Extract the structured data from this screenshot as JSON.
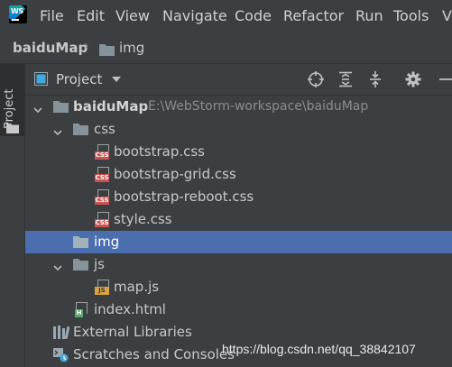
{
  "app": {
    "logo_text": "WS"
  },
  "menu": {
    "items": [
      {
        "label": "File",
        "name": "menu-file"
      },
      {
        "label": "Edit",
        "name": "menu-edit"
      },
      {
        "label": "View",
        "name": "menu-view"
      },
      {
        "label": "Navigate",
        "name": "menu-navigate"
      },
      {
        "label": "Code",
        "name": "menu-code"
      },
      {
        "label": "Refactor",
        "name": "menu-refactor"
      },
      {
        "label": "Run",
        "name": "menu-run"
      },
      {
        "label": "Tools",
        "name": "menu-tools"
      },
      {
        "label": "V",
        "name": "menu-vcs-truncated"
      }
    ]
  },
  "breadcrumb": {
    "project": "baiduMap",
    "separator": "›",
    "folder": "img"
  },
  "toolstrip": {
    "project_tab_label": "Project"
  },
  "project_panel": {
    "title": "Project",
    "tools": [
      "locate-icon",
      "expand-all-icon",
      "collapse-all-icon",
      "gear-icon",
      "hide-icon"
    ]
  },
  "tree": {
    "root": {
      "label": "baiduMap",
      "path": "E:\\WebStorm-workspace\\baiduMap"
    },
    "css_folder": "css",
    "css_files": [
      "bootstrap.css",
      "bootstrap-grid.css",
      "bootstrap-reboot.css",
      "style.css"
    ],
    "img_folder": "img",
    "js_folder": "js",
    "js_files": [
      "map.js"
    ],
    "index_file": "index.html",
    "external_libraries": "External Libraries",
    "scratches": "Scratches and Consoles"
  },
  "icon_tags": {
    "css": "CSS",
    "js": "JS",
    "html": "H"
  },
  "watermark": "https://blog.csdn.net/qq_38842107",
  "colors": {
    "background": "#3c3f41",
    "selection": "#4b6eaf",
    "folder": "#87939a",
    "css_tag": "#c75450",
    "js_tag": "#d9a343",
    "html_tag": "#59a869"
  }
}
